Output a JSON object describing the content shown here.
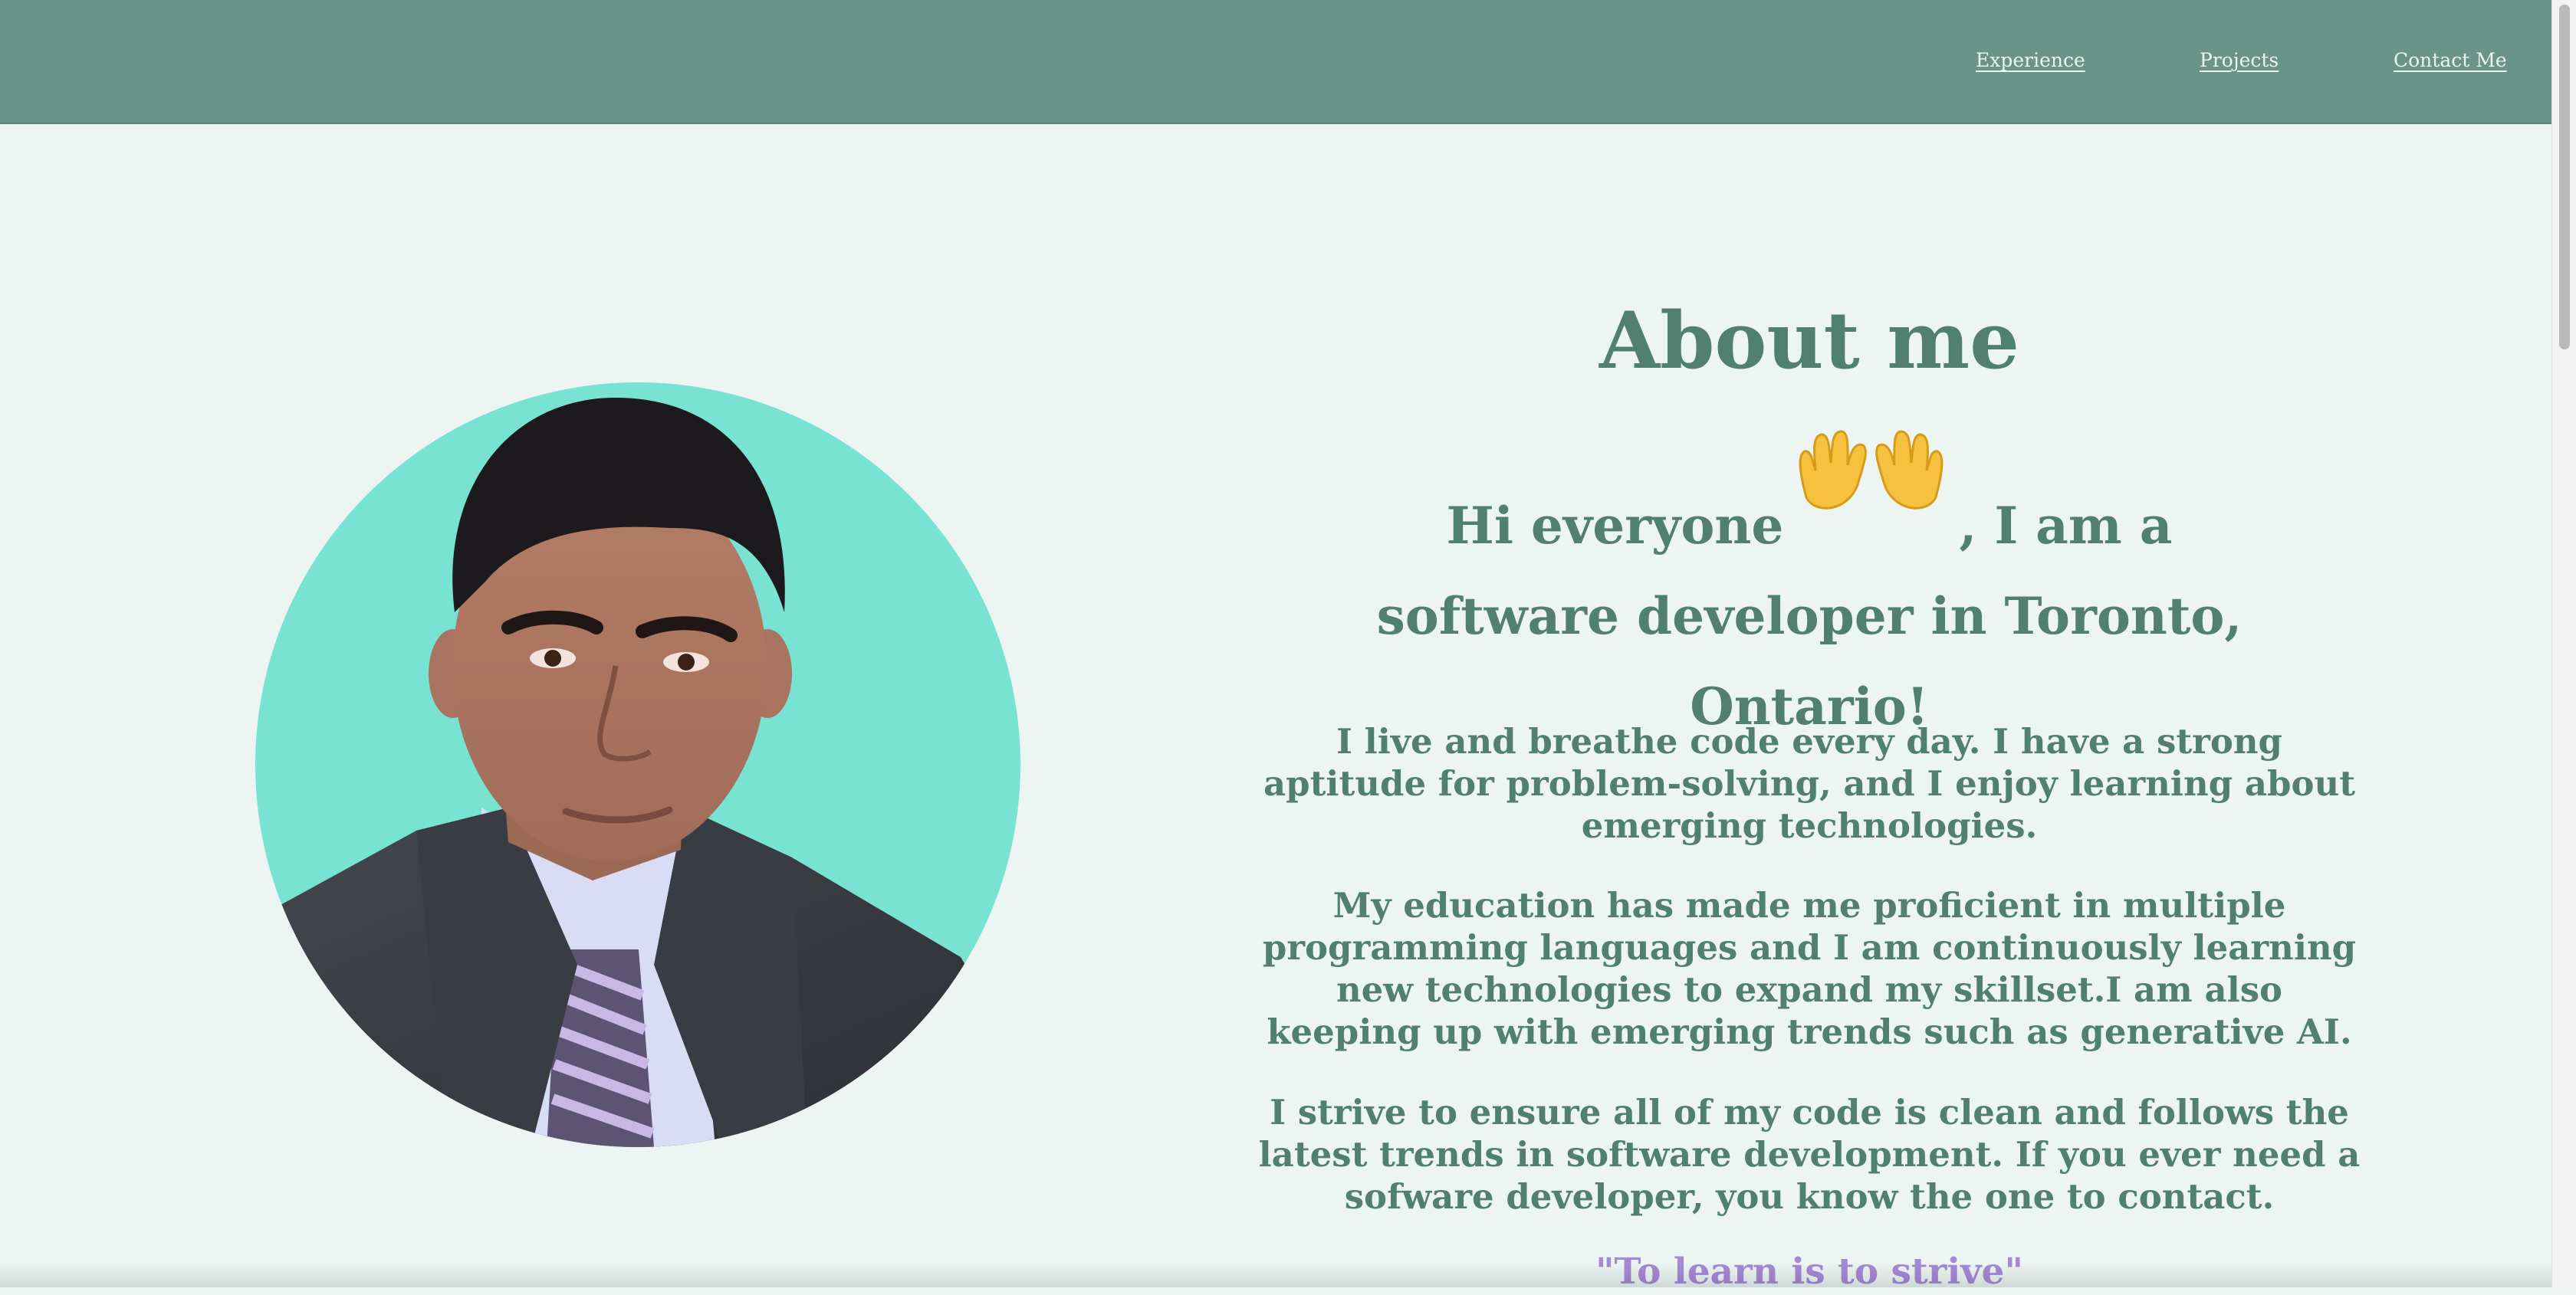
{
  "nav": {
    "experience": "Experience",
    "projects": "Projects",
    "contact": "Contact Me"
  },
  "about": {
    "title": "About me",
    "hello_before": "Hi everyone",
    "hello_after": ", I am a software developer in Toronto, Ontario!",
    "paragraph1": "I live and breathe code every day. I have a strong aptitude for problem-solving, and I enjoy learning about emerging technologies.",
    "paragraph2": "My education has made me proficient in multiple programming languages and I am continuously learning new technologies to expand my skillset.I am also keeping up with emerging trends such as generative AI.",
    "paragraph3": "I strive to ensure all of my code is clean and follows the latest trends in software development. If you ever need a sofware developer, you know the one to contact.",
    "quote": "\"To learn is to strive\""
  },
  "icons": {
    "hands": "open-hands-icon",
    "portrait": "profile-photo"
  },
  "colors": {
    "header_bg": "#6b9489",
    "page_bg": "#edf5f3",
    "text": "#518070",
    "quote": "#a48ad6",
    "photo_bg": "#78e3d2"
  }
}
